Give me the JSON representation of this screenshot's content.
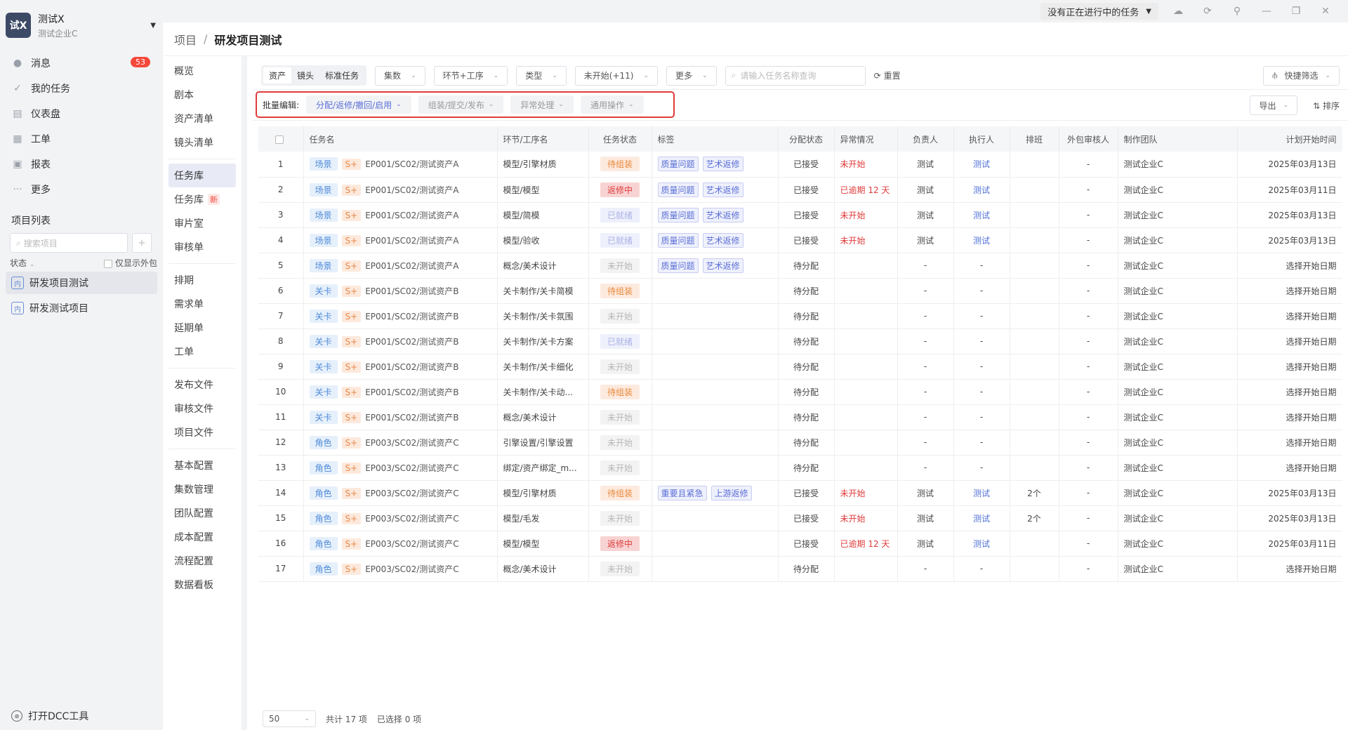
{
  "window": {
    "task_status": "没有正在进行中的任务"
  },
  "sidebar": {
    "logo": "试X",
    "brand_name": "测试X",
    "brand_sub": "测试企业C",
    "items": [
      {
        "label": "消息",
        "badge": "53"
      },
      {
        "label": "我的任务"
      },
      {
        "label": "仪表盘"
      },
      {
        "label": "工单"
      },
      {
        "label": "报表"
      },
      {
        "label": "更多"
      }
    ],
    "project_list_title": "项目列表",
    "search_placeholder": "搜索项目",
    "status_label": "状态",
    "outsource_label": "仅显示外包",
    "projects": [
      {
        "icon": "内",
        "name": "研发项目测试"
      },
      {
        "icon": "内",
        "name": "研发测试项目"
      }
    ],
    "dcc_label": "打开DCC工具"
  },
  "breadcrumb": {
    "parent": "项目",
    "current": "研发项目测试"
  },
  "subnav": [
    [
      "概览",
      "剧本",
      "资产清单",
      "镜头清单"
    ],
    [
      "任务库",
      "任务库",
      "审片室",
      "审核单"
    ],
    [
      "排期",
      "需求单",
      "延期单",
      "工单"
    ],
    [
      "发布文件",
      "审核文件",
      "项目文件"
    ],
    [
      "基本配置",
      "集数管理",
      "团队配置",
      "成本配置",
      "流程配置",
      "数据看板"
    ]
  ],
  "subnav_new": "新",
  "toolbar": {
    "tabs": [
      "资产",
      "镜头",
      "标准任务"
    ],
    "filters": [
      "集数",
      "环节+工序",
      "类型",
      "未开始(+11)",
      "更多"
    ],
    "search_placeholder": "请输入任务名称查询",
    "reset": "重置",
    "quick_filter": "快捷筛选"
  },
  "batch": {
    "label": "批量编辑:",
    "buttons": [
      "分配/返修/撤回/启用",
      "组装/提交/发布",
      "异常处理",
      "通用操作"
    ],
    "export": "导出",
    "sort": "排序"
  },
  "table": {
    "headers": [
      "",
      "任务名",
      "环节/工序名",
      "任务状态",
      "标签",
      "分配状态",
      "异常情况",
      "负责人",
      "执行人",
      "排班",
      "外包审核人",
      "制作团队",
      "计划开始时间"
    ],
    "rows": [
      {
        "n": "1",
        "type": "场景",
        "lv": "S+",
        "name": "EP001/SC02/测试资产A",
        "step": "模型/引擎材质",
        "status": "待组装",
        "sk": "wait",
        "tags": [
          "质量问题",
          "艺术返修"
        ],
        "assign": "已接受",
        "ex": "未开始",
        "owner": "测试",
        "exec": "测试",
        "shift": "",
        "ob": "-",
        "team": "测试企业C",
        "start": "2025年03月13日"
      },
      {
        "n": "2",
        "type": "场景",
        "lv": "S+",
        "name": "EP001/SC02/测试资产A",
        "step": "模型/模型",
        "status": "返修中",
        "sk": "fix",
        "tags": [
          "质量问题",
          "艺术返修"
        ],
        "assign": "已接受",
        "ex": "已逾期 12 天",
        "owner": "测试",
        "exec": "测试",
        "shift": "",
        "ob": "-",
        "team": "测试企业C",
        "start": "2025年03月11日"
      },
      {
        "n": "3",
        "type": "场景",
        "lv": "S+",
        "name": "EP001/SC02/测试资产A",
        "step": "模型/简模",
        "status": "已就绪",
        "sk": "ready",
        "tags": [
          "质量问题",
          "艺术返修"
        ],
        "assign": "已接受",
        "ex": "未开始",
        "owner": "测试",
        "exec": "测试",
        "shift": "",
        "ob": "-",
        "team": "测试企业C",
        "start": "2025年03月13日"
      },
      {
        "n": "4",
        "type": "场景",
        "lv": "S+",
        "name": "EP001/SC02/测试资产A",
        "step": "模型/验收",
        "status": "已就绪",
        "sk": "ready",
        "tags": [
          "质量问题",
          "艺术返修"
        ],
        "assign": "已接受",
        "ex": "未开始",
        "owner": "测试",
        "exec": "测试",
        "shift": "",
        "ob": "-",
        "team": "测试企业C",
        "start": "2025年03月13日"
      },
      {
        "n": "5",
        "type": "场景",
        "lv": "S+",
        "name": "EP001/SC02/测试资产A",
        "step": "概念/美术设计",
        "status": "未开始",
        "sk": "not",
        "tags": [
          "质量问题",
          "艺术返修"
        ],
        "assign": "待分配",
        "ex": "",
        "owner": "-",
        "exec": "-",
        "shift": "",
        "ob": "-",
        "team": "测试企业C",
        "start": "选择开始日期"
      },
      {
        "n": "6",
        "type": "关卡",
        "lv": "S+",
        "name": "EP001/SC02/测试资产B",
        "step": "关卡制作/关卡简模",
        "status": "待组装",
        "sk": "wait",
        "tags": [],
        "assign": "待分配",
        "ex": "",
        "owner": "-",
        "exec": "-",
        "shift": "",
        "ob": "-",
        "team": "测试企业C",
        "start": "选择开始日期"
      },
      {
        "n": "7",
        "type": "关卡",
        "lv": "S+",
        "name": "EP001/SC02/测试资产B",
        "step": "关卡制作/关卡氛围",
        "status": "未开始",
        "sk": "not",
        "tags": [],
        "assign": "待分配",
        "ex": "",
        "owner": "-",
        "exec": "-",
        "shift": "",
        "ob": "-",
        "team": "测试企业C",
        "start": "选择开始日期"
      },
      {
        "n": "8",
        "type": "关卡",
        "lv": "S+",
        "name": "EP001/SC02/测试资产B",
        "step": "关卡制作/关卡方案",
        "status": "已就绪",
        "sk": "ready",
        "tags": [],
        "assign": "待分配",
        "ex": "",
        "owner": "-",
        "exec": "-",
        "shift": "",
        "ob": "-",
        "team": "测试企业C",
        "start": "选择开始日期"
      },
      {
        "n": "9",
        "type": "关卡",
        "lv": "S+",
        "name": "EP001/SC02/测试资产B",
        "step": "关卡制作/关卡细化",
        "status": "未开始",
        "sk": "not",
        "tags": [],
        "assign": "待分配",
        "ex": "",
        "owner": "-",
        "exec": "-",
        "shift": "",
        "ob": "-",
        "team": "测试企业C",
        "start": "选择开始日期"
      },
      {
        "n": "10",
        "type": "关卡",
        "lv": "S+",
        "name": "EP001/SC02/测试资产B",
        "step": "关卡制作/关卡动...",
        "status": "待组装",
        "sk": "wait",
        "tags": [],
        "assign": "待分配",
        "ex": "",
        "owner": "-",
        "exec": "-",
        "shift": "",
        "ob": "-",
        "team": "测试企业C",
        "start": "选择开始日期"
      },
      {
        "n": "11",
        "type": "关卡",
        "lv": "S+",
        "name": "EP001/SC02/测试资产B",
        "step": "概念/美术设计",
        "status": "未开始",
        "sk": "not",
        "tags": [],
        "assign": "待分配",
        "ex": "",
        "owner": "-",
        "exec": "-",
        "shift": "",
        "ob": "-",
        "team": "测试企业C",
        "start": "选择开始日期"
      },
      {
        "n": "12",
        "type": "角色",
        "lv": "S+",
        "name": "EP003/SC02/测试资产C",
        "step": "引擎设置/引擎设置",
        "status": "未开始",
        "sk": "not",
        "tags": [],
        "assign": "待分配",
        "ex": "",
        "owner": "-",
        "exec": "-",
        "shift": "",
        "ob": "-",
        "team": "测试企业C",
        "start": "选择开始日期"
      },
      {
        "n": "13",
        "type": "角色",
        "lv": "S+",
        "name": "EP003/SC02/测试资产C",
        "step": "绑定/资产绑定_m...",
        "status": "未开始",
        "sk": "not",
        "tags": [],
        "assign": "待分配",
        "ex": "",
        "owner": "-",
        "exec": "-",
        "shift": "",
        "ob": "-",
        "team": "测试企业C",
        "start": "选择开始日期"
      },
      {
        "n": "14",
        "type": "角色",
        "lv": "S+",
        "name": "EP003/SC02/测试资产C",
        "step": "模型/引擎材质",
        "status": "待组装",
        "sk": "wait",
        "tags": [
          "重要且紧急",
          "上游返修"
        ],
        "assign": "已接受",
        "ex": "未开始",
        "owner": "测试",
        "exec": "测试",
        "shift": "2个",
        "ob": "-",
        "team": "测试企业C",
        "start": "2025年03月13日"
      },
      {
        "n": "15",
        "type": "角色",
        "lv": "S+",
        "name": "EP003/SC02/测试资产C",
        "step": "模型/毛发",
        "status": "未开始",
        "sk": "not",
        "tags": [],
        "assign": "已接受",
        "ex": "未开始",
        "owner": "测试",
        "exec": "测试",
        "shift": "2个",
        "ob": "-",
        "team": "测试企业C",
        "start": "2025年03月13日"
      },
      {
        "n": "16",
        "type": "角色",
        "lv": "S+",
        "name": "EP003/SC02/测试资产C",
        "step": "模型/模型",
        "status": "返修中",
        "sk": "fix",
        "tags": [],
        "assign": "已接受",
        "ex": "已逾期 12 天",
        "owner": "测试",
        "exec": "测试",
        "shift": "",
        "ob": "-",
        "team": "测试企业C",
        "start": "2025年03月11日"
      },
      {
        "n": "17",
        "type": "角色",
        "lv": "S+",
        "name": "EP003/SC02/测试资产C",
        "step": "概念/美术设计",
        "status": "未开始",
        "sk": "not",
        "tags": [],
        "assign": "待分配",
        "ex": "",
        "owner": "-",
        "exec": "-",
        "shift": "",
        "ob": "-",
        "team": "测试企业C",
        "start": "选择开始日期"
      }
    ]
  },
  "footer": {
    "page_size": "50",
    "total": "共计 17 项",
    "selected": "已选择 0 项"
  }
}
